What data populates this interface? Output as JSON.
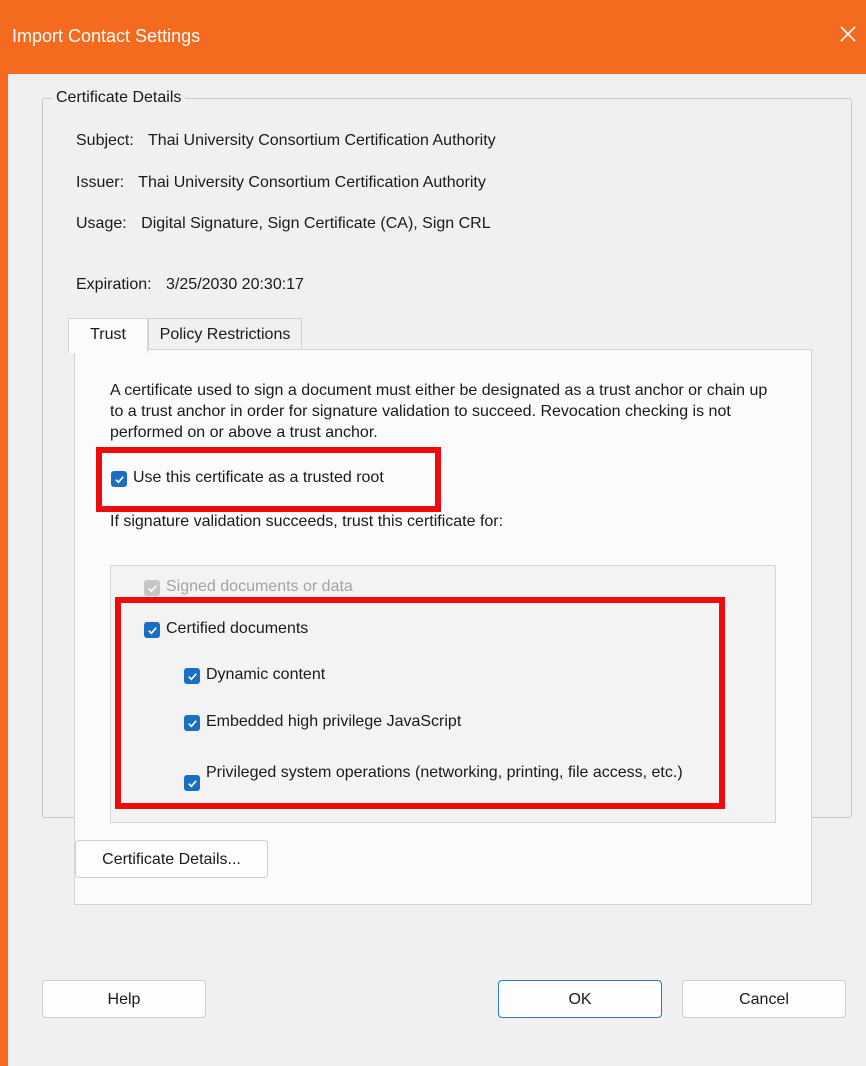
{
  "window": {
    "title": "Import Contact Settings"
  },
  "group": {
    "legend": "Certificate Details"
  },
  "details": {
    "subject_label": "Subject:",
    "subject_value": "Thai University Consortium Certification Authority",
    "issuer_label": "Issuer:",
    "issuer_value": "Thai University Consortium Certification Authority",
    "usage_label": "Usage:",
    "usage_value": "Digital Signature, Sign Certificate (CA), Sign CRL",
    "expiration_label": "Expiration:",
    "expiration_value": "3/25/2030 20:30:17"
  },
  "tabs": [
    {
      "label": "Trust",
      "selected": true
    },
    {
      "label": "Policy Restrictions",
      "selected": false
    }
  ],
  "trust": {
    "description": "A certificate used to sign a document must either be designated as a trust anchor or chain up to a trust anchor in order for signature validation to succeed.  Revocation checking is not performed on or above a trust anchor.",
    "trusted_root_label": "Use this certificate as a trusted root",
    "trust_for_label": "If signature validation succeeds, trust this certificate for:",
    "options": {
      "signed_docs": "Signed documents or data",
      "certified_docs": "Certified documents",
      "dynamic_content": "Dynamic content",
      "embedded_js": "Embedded high privilege JavaScript",
      "privileged_ops": "Privileged system operations (networking, printing, file access, etc.)"
    }
  },
  "buttons": {
    "certificate_details": "Certificate Details...",
    "help": "Help",
    "ok": "OK",
    "cancel": "Cancel"
  },
  "colors": {
    "titlebar": "#f46a1e",
    "checkbox": "#1a6fc2",
    "highlight": "#ee0b0b"
  },
  "icons": {
    "close": "close-icon",
    "check": "checkmark-icon"
  }
}
